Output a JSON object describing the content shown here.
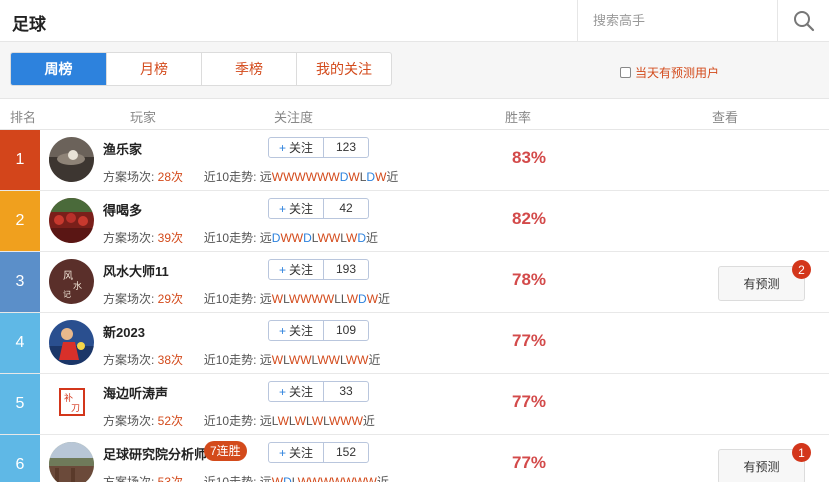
{
  "header": {
    "title": "足球",
    "search_placeholder": "搜索高手",
    "search_icon": "search-icon"
  },
  "tabs": [
    {
      "label": "周榜",
      "active": true
    },
    {
      "label": "月榜",
      "active": false
    },
    {
      "label": "季榜",
      "active": false
    },
    {
      "label": "我的关注",
      "active": false
    }
  ],
  "filter": {
    "label": "当天有预测用户",
    "checked": false
  },
  "columns": {
    "rank": "排名",
    "player": "玩家",
    "follow": "关注度",
    "winrate": "胜率",
    "view": "查看"
  },
  "labels": {
    "follow_button": "关注",
    "plans_prefix": "方案场次:",
    "trend_prefix": "近10走势:",
    "trend_far": "远",
    "trend_near": "近",
    "predict_button": "有预测"
  },
  "colors": {
    "rank1": "#d3451b",
    "rank2": "#f0a01e",
    "rank3": "#5b8fc9",
    "rank_other": "#5fb8e6",
    "accent": "#2d82dd",
    "red": "#d34a1b"
  },
  "players": [
    {
      "rank": "1",
      "name": "渔乐家",
      "streak": "",
      "followers": "123",
      "plans": "28次",
      "trend": "WWWWWWDWLDW",
      "winrate": "83%",
      "has_prediction": false,
      "prediction_count": ""
    },
    {
      "rank": "2",
      "name": "得喝多",
      "streak": "",
      "followers": "42",
      "plans": "39次",
      "trend": "DWWDLWWLWD",
      "winrate": "82%",
      "has_prediction": false,
      "prediction_count": ""
    },
    {
      "rank": "3",
      "name": "风水大师11",
      "streak": "",
      "followers": "193",
      "plans": "29次",
      "trend": "WLWWWWLLWDW",
      "winrate": "78%",
      "has_prediction": true,
      "prediction_count": "2"
    },
    {
      "rank": "4",
      "name": "新2023",
      "streak": "",
      "followers": "109",
      "plans": "38次",
      "trend": "WLWWLWWLWW",
      "winrate": "77%",
      "has_prediction": false,
      "prediction_count": ""
    },
    {
      "rank": "5",
      "name": "海边听涛声",
      "streak": "",
      "followers": "33",
      "plans": "52次",
      "trend": "LWLWLWLWWW",
      "winrate": "77%",
      "has_prediction": false,
      "prediction_count": ""
    },
    {
      "rank": "6",
      "name": "足球研究院分析师",
      "streak": "7连胜",
      "followers": "152",
      "plans": "53次",
      "trend": "WDLWWWWWWW",
      "winrate": "77%",
      "has_prediction": true,
      "prediction_count": "1"
    }
  ]
}
